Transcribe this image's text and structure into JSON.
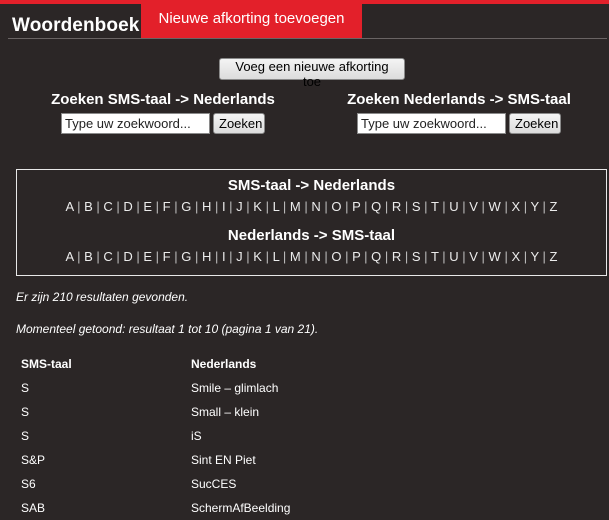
{
  "header": {
    "brand": "Woordenboek",
    "active_tab": "Nieuwe afkorting toevoegen"
  },
  "add_button_label": "Voeg een nieuwe afkorting toe",
  "search": {
    "sms_to_nl": {
      "title": "Zoeken SMS-taal -> Nederlands",
      "placeholder": "Type uw zoekwoord...",
      "button": "Zoeken"
    },
    "nl_to_sms": {
      "title": "Zoeken Nederlands -> SMS-taal",
      "placeholder": "Type uw zoekwoord...",
      "button": "Zoeken"
    }
  },
  "alphabet": {
    "sms_to_nl_title": "SMS-taal -> Nederlands",
    "nl_to_sms_title": "Nederlands -> SMS-taal",
    "letters": [
      "A",
      "B",
      "C",
      "D",
      "E",
      "F",
      "G",
      "H",
      "I",
      "J",
      "K",
      "L",
      "M",
      "N",
      "O",
      "P",
      "Q",
      "R",
      "S",
      "T",
      "U",
      "V",
      "W",
      "X",
      "Y",
      "Z"
    ]
  },
  "results_info": "Er zijn 210 resultaten gevonden.",
  "current_info": "Momenteel getoond: resultaat 1 tot 10 (pagina 1 van 21).",
  "table": {
    "columns": [
      "SMS-taal",
      "Nederlands"
    ],
    "rows": [
      [
        "S",
        "Smile – glimlach"
      ],
      [
        "S",
        "Small – klein"
      ],
      [
        "S",
        "iS"
      ],
      [
        "S&P",
        "Sint EN Piet"
      ],
      [
        "S6",
        "SucCES"
      ],
      [
        "SAB",
        "SchermAfBeelding"
      ]
    ]
  },
  "colors": {
    "background": "#2b2626",
    "accent": "#e3202a",
    "text": "#ffffff"
  }
}
